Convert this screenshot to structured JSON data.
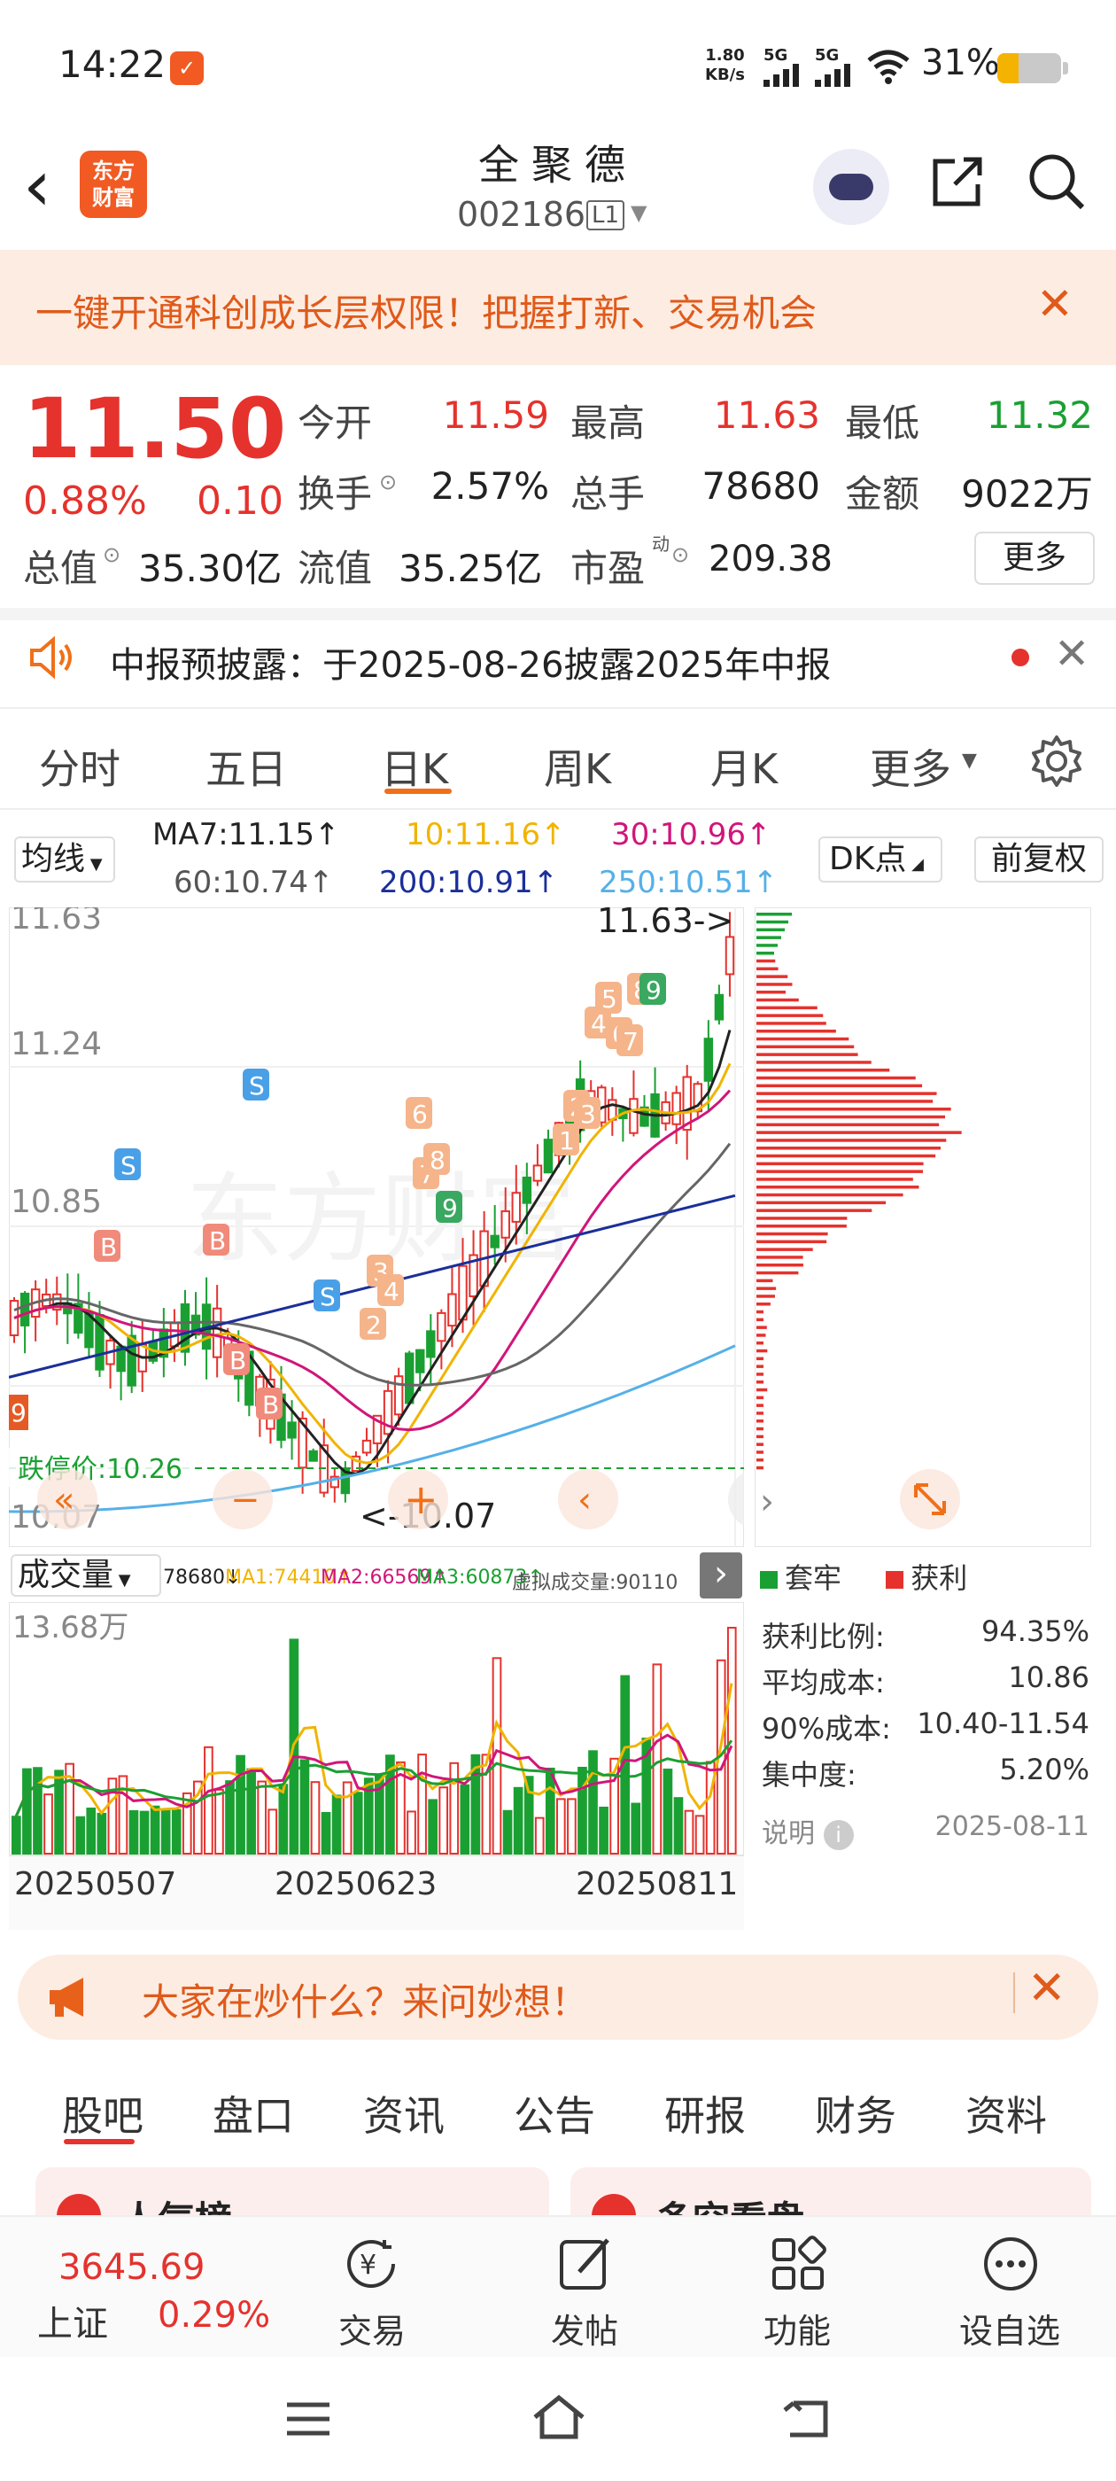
{
  "status_bar": {
    "time": "14:22",
    "net_speed_value": "1.80",
    "net_speed_unit": "KB/s",
    "sig1_label": "5G",
    "sig2_label": "5G",
    "battery": "31%"
  },
  "header": {
    "logo_line1": "东方",
    "logo_line2": "财富",
    "stock_name": "全聚德",
    "stock_code": "002186",
    "code_tag": "L1"
  },
  "banner": {
    "text": "一键开通科创成长层权限！把握打新、交易机会"
  },
  "quote": {
    "price": "11.50",
    "change_pct": "0.88%",
    "change": "0.10",
    "open_label": "今开",
    "open": "11.59",
    "high_label": "最高",
    "high": "11.63",
    "low_label": "最低",
    "low": "11.32",
    "turnover_label": "换手",
    "turnover": "2.57%",
    "volume_label": "总手",
    "volume": "78680",
    "amount_label": "金额",
    "amount": "9022万",
    "mcap_label": "总值",
    "mcap": "35.30亿",
    "float_label": "流值",
    "float_mcap": "35.25亿",
    "pe_label": "市盈",
    "pe_sup": "动",
    "pe": "209.38",
    "more_label": "更多"
  },
  "notice": {
    "text": "中报预披露：于2025-08-26披露2025年中报"
  },
  "period_tabs": [
    "分时",
    "五日",
    "日K",
    "周K",
    "月K",
    "更多"
  ],
  "ma_row": {
    "selector": "均线",
    "ma7": "MA7:11.15",
    "ma10": "10:11.16",
    "ma30": "30:10.96",
    "ma60": "60:10.74",
    "ma200": "200:10.91",
    "ma250": "250:10.51",
    "dk_label": "DK点",
    "adj_label": "前复权"
  },
  "colors": {
    "up": "#e5322d",
    "down": "#1aa032",
    "ma7": "#222222",
    "ma10": "#f0b400",
    "ma30": "#d0167a",
    "ma60": "#666666",
    "ma200": "#1a2f9a",
    "ma250": "#55b0e8"
  },
  "kchart": {
    "y_labels": [
      "11.63",
      "11.24",
      "10.85",
      "10.07"
    ],
    "high_marker": "11.63->",
    "low_marker": "<-10.07",
    "limit_down_label": "跌停价:10.26",
    "watermark": "东方财富",
    "signal_labels": [
      "S",
      "S",
      "S",
      "B",
      "B",
      "B",
      "B",
      "1",
      "2",
      "3",
      "4",
      "5",
      "6",
      "7",
      "8",
      "9",
      "3",
      "4",
      "2",
      "6",
      "7",
      "8",
      "9",
      "1",
      "2",
      "3",
      "4",
      "5",
      "6",
      "7",
      "8",
      "9"
    ],
    "side_tag": "9"
  },
  "volume": {
    "selector": "成交量",
    "indicators": [
      "78680",
      "MA1:74410",
      "MA2:66569",
      "MA3:60873",
      "虚拟成交量:90110"
    ],
    "max_label": "13.68万",
    "dates": [
      "20250507",
      "20250623",
      "20250811"
    ]
  },
  "distribution": {
    "legend_lock": "套牢",
    "legend_profit": "获利",
    "stats": [
      {
        "label": "获利比例:",
        "value": "94.35%"
      },
      {
        "label": "平均成本:",
        "value": "10.86"
      },
      {
        "label": "90%成本:",
        "value": "10.40-11.54"
      },
      {
        "label": "集中度:",
        "value": "5.20%"
      }
    ],
    "note_label": "说明",
    "date": "2025-08-11"
  },
  "ask": {
    "text": "大家在炒什么？来问妙想！"
  },
  "sub_tabs": [
    "股吧",
    "盘口",
    "资讯",
    "公告",
    "研报",
    "财务",
    "资料"
  ],
  "cards": {
    "left_title": "人气榜",
    "right_title": "多空看盘"
  },
  "bottom_bar": {
    "index_value": "3645.69",
    "index_name": "上证",
    "index_pct": "0.29%",
    "items": [
      "交易",
      "发帖",
      "功能",
      "设自选"
    ]
  }
}
